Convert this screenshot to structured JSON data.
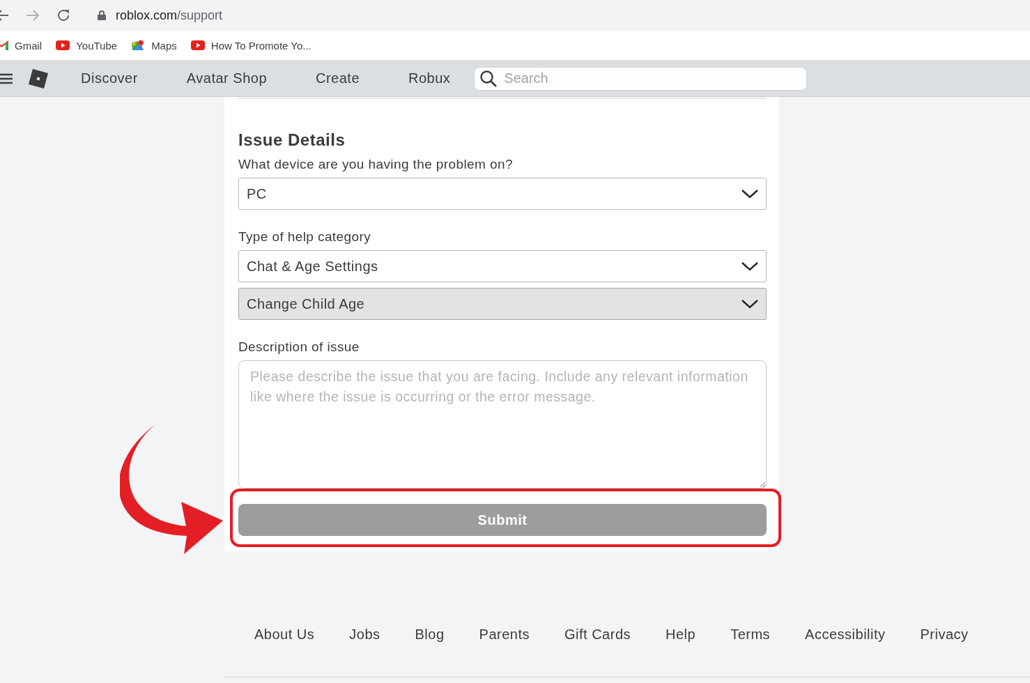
{
  "browser": {
    "url_host": "roblox.com",
    "url_path": "/support"
  },
  "bookmarks": [
    {
      "label": "Gmail",
      "kind": "gmail"
    },
    {
      "label": "YouTube",
      "kind": "youtube"
    },
    {
      "label": "Maps",
      "kind": "maps"
    },
    {
      "label": "How To Promote Yo...",
      "kind": "youtube"
    }
  ],
  "nav": {
    "items": [
      "Discover",
      "Avatar Shop",
      "Create",
      "Robux"
    ],
    "search": {
      "placeholder": "Search"
    }
  },
  "form": {
    "heading": "Issue Details",
    "fields": [
      {
        "kind": "select",
        "label": "What device are you having the problem on?",
        "value": "PC",
        "disabled": false
      },
      {
        "kind": "select",
        "label": "Type of help category",
        "value": "Chat & Age Settings",
        "disabled": false
      },
      {
        "kind": "select",
        "value": "Change Child Age",
        "disabled": true
      },
      {
        "kind": "textarea",
        "label": "Description of issue",
        "placeholder": "Please describe the issue that you are facing. Include any relevant information like where the issue is occurring or the error message."
      }
    ],
    "submit": {
      "label": "Submit",
      "disabled": true,
      "highlighted": true
    }
  },
  "footer": [
    "About Us",
    "Jobs",
    "Blog",
    "Parents",
    "Gift Cards",
    "Help",
    "Terms",
    "Accessibility",
    "Privacy"
  ]
}
